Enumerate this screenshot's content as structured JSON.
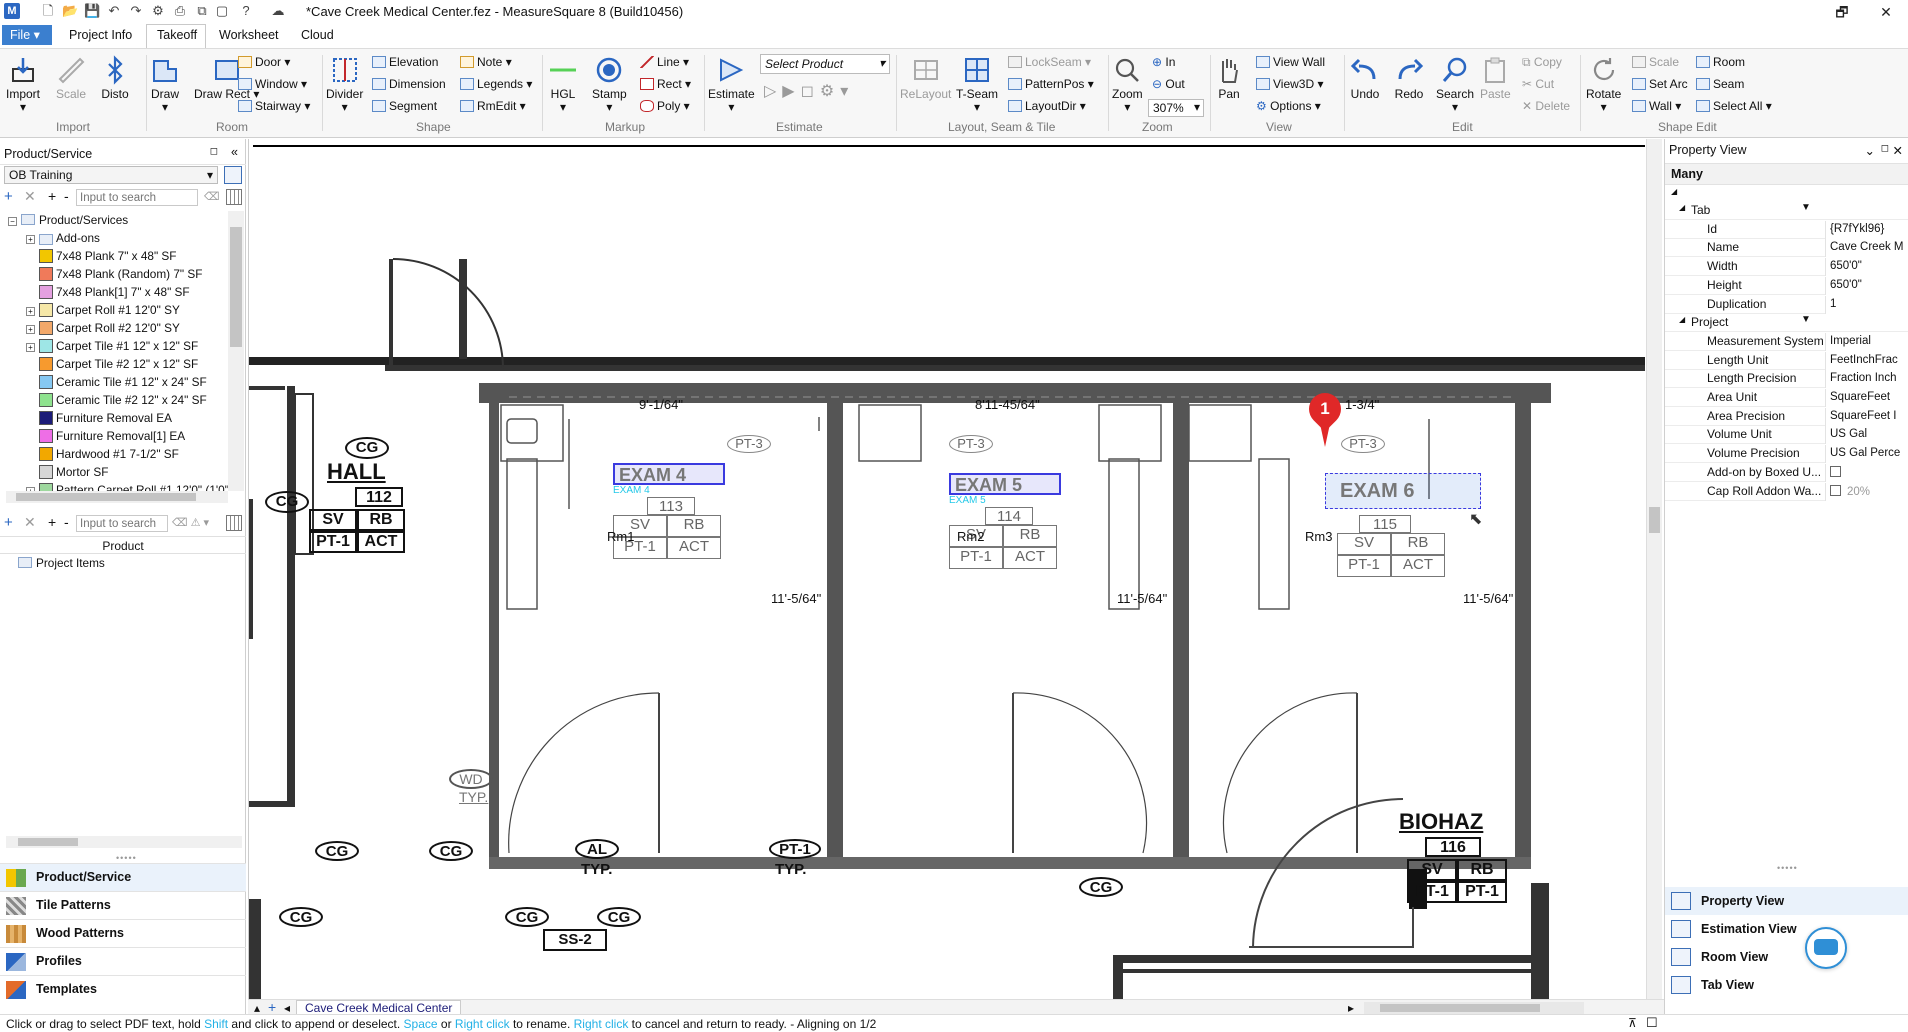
{
  "window": {
    "title": "*Cave Creek Medical Center.fez - MeasureSquare 8 (Build10456)",
    "restore_glyph": "🗗"
  },
  "menu": {
    "file": "File",
    "tabs": [
      "Project Info",
      "Takeoff",
      "Worksheet",
      "Cloud"
    ]
  },
  "ribbon": {
    "import": {
      "label": "Import",
      "buttons": [
        "Import",
        "Scale",
        "Disto"
      ]
    },
    "room": {
      "label": "Room",
      "big": [
        "Draw",
        "Draw Rect"
      ],
      "small": [
        "Door",
        "Window",
        "Stairway"
      ]
    },
    "shape": {
      "label": "Shape",
      "big": [
        "Divider"
      ],
      "small": [
        "Elevation",
        "Dimension",
        "Segment",
        "Note",
        "Legends",
        "RmEdit"
      ]
    },
    "markup": {
      "label": "Markup",
      "big": [
        "HGL",
        "Stamp"
      ],
      "small": [
        "Line",
        "Rect",
        "Poly"
      ]
    },
    "estimate": {
      "label": "Estimate",
      "big": "Estimate",
      "select_placeholder": "Select Product"
    },
    "layout": {
      "label": "Layout, Seam & Tile",
      "big": [
        "ReLayout",
        "T-Seam"
      ],
      "small": [
        "LockSeam",
        "PatternPos",
        "LayoutDir"
      ]
    },
    "zoom": {
      "label": "Zoom",
      "big": "Zoom",
      "small": [
        "In",
        "Out"
      ],
      "level": "307%"
    },
    "view": {
      "label": "View",
      "big": "Pan",
      "small": [
        "View Wall",
        "View3D",
        "Options"
      ]
    },
    "edit": {
      "label": "Edit",
      "big": [
        "Undo",
        "Redo",
        "Search",
        "Paste"
      ],
      "small": [
        "Copy",
        "Cut",
        "Delete"
      ]
    },
    "shape_edit": {
      "label": "Shape Edit",
      "big": "Rotate",
      "small": [
        "Scale",
        "Set Arc",
        "Wall",
        "Room",
        "Seam",
        "Select All"
      ]
    }
  },
  "left": {
    "header": "Product/Service",
    "dropdown": "OB Training",
    "search_placeholder": "Input to search",
    "root": "Product/Services",
    "items": [
      {
        "label": "Add-ons",
        "folder": true,
        "color": ""
      },
      {
        "label": "7x48 Plank 7\" x 48\" SF",
        "color": "#f2c600"
      },
      {
        "label": "7x48 Plank (Random) 7\" SF",
        "color": "#f07a5a"
      },
      {
        "label": "7x48 Plank[1] 7\" x 48\" SF",
        "color": "#e4a0e0"
      },
      {
        "label": "Carpet Roll #1 12'0\" SY",
        "color": "#f6e8a8",
        "expand": true
      },
      {
        "label": "Carpet Roll #2 12'0\" SY",
        "color": "#f2a86a",
        "expand": true
      },
      {
        "label": "Carpet Tile #1 12\" x 12\" SF",
        "color": "#9ee6e6",
        "expand": true
      },
      {
        "label": "Carpet Tile #2 12\" x 12\" SF",
        "color": "#f79a2e"
      },
      {
        "label": "Ceramic Tile #1 12\" x 24\" SF",
        "color": "#86c8f2"
      },
      {
        "label": "Ceramic Tile #2 12\" x 24\" SF",
        "color": "#8ee28e"
      },
      {
        "label": "Furniture Removal EA",
        "color": "#1b1b78"
      },
      {
        "label": "Furniture Removal[1] EA",
        "color": "#ee6ee6"
      },
      {
        "label": "Hardwood #1 7-1/2\" SF",
        "color": "#f2a800"
      },
      {
        "label": "Mortor SF",
        "color": "#d6d6d6"
      },
      {
        "label": "Pattern Carpet Roll #1 12'0\" (1'0\"",
        "color": "#9ed89e",
        "expand": true
      }
    ],
    "product_header": "Product",
    "project_items": "Project Items",
    "nav": [
      "Product/Service",
      "Tile Patterns",
      "Wood Patterns",
      "Profiles",
      "Templates"
    ]
  },
  "canvas": {
    "dims": [
      "9'-1/64\"",
      "8'11-45/64\"",
      "1-3/4\"",
      "11'-5/64\"",
      "11'-5/64\"",
      "11'-5/64\""
    ],
    "rooms": [
      "Rm1",
      "Rm2",
      "Rm3"
    ],
    "exam_labels": [
      "EXAM 4",
      "EXAM 5"
    ],
    "marker": "1",
    "plan_tags": [
      "CG",
      "HALL",
      "112",
      "SV",
      "RB",
      "PT-1",
      "ACT",
      "PT-3",
      "113",
      "114",
      "115",
      "116",
      "BIOHAZ",
      "AL",
      "TYP.",
      "WD",
      "SS-2",
      "EXAM 4",
      "EXAM 5",
      "EXAM 6"
    ]
  },
  "docbar": {
    "tab": "Cave Creek Medical Center"
  },
  "right": {
    "header": "Property View",
    "selection": "Many",
    "rows": [
      {
        "type": "section",
        "label": "Tab"
      },
      {
        "label": "Id",
        "value": "{R7fYkl96}"
      },
      {
        "label": "Name",
        "value": "Cave Creek M"
      },
      {
        "label": "Width",
        "value": "650'0\""
      },
      {
        "label": "Height",
        "value": "650'0\""
      },
      {
        "label": "Duplication",
        "value": "1"
      },
      {
        "type": "section",
        "label": "Project"
      },
      {
        "label": "Measurement System",
        "value": "Imperial"
      },
      {
        "label": "Length Unit",
        "value": "FeetInchFrac"
      },
      {
        "label": "Length Precision",
        "value": "Fraction Inch"
      },
      {
        "label": "Area Unit",
        "value": "SquareFeet"
      },
      {
        "label": "Area Precision",
        "value": "SquareFeet I"
      },
      {
        "label": "Volume Unit",
        "value": "US Gal"
      },
      {
        "label": "Volume Precision",
        "value": "US Gal Perce"
      },
      {
        "label": "Add-on by Boxed U...",
        "checkbox": true
      },
      {
        "label": "Cap Roll Addon Wa...",
        "checkbox": true,
        "value": "20%"
      }
    ],
    "nav": [
      "Property View",
      "Estimation View",
      "Room View",
      "Tab View"
    ]
  },
  "status": {
    "pre": "Click or drag to select PDF text, hold ",
    "shift": "Shift",
    "mid": " and click to append or deselect. ",
    "space": "Space",
    "or": " or ",
    "rclick": "Right click",
    "torename": " to rename.  ",
    "rclick2": "Right click",
    "post": " to cancel and return to ready. - Aligning on 1/2"
  },
  "colors": {
    "accent": "#3b7fcf",
    "selection": "#3a3adf",
    "marker": "#e02828"
  }
}
